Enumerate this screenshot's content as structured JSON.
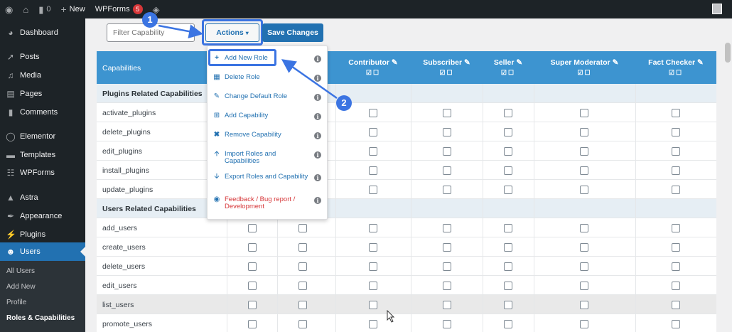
{
  "adminbar": {
    "comments_count": "0",
    "new_label": "New",
    "wpforms_label": "WPForms",
    "wpforms_badge": "5"
  },
  "sidebar": {
    "items": [
      {
        "label": "Dashboard",
        "icon": "dashboard-icon"
      },
      {
        "label": "Posts",
        "icon": "pin-icon"
      },
      {
        "label": "Media",
        "icon": "media-icon"
      },
      {
        "label": "Pages",
        "icon": "pages-icon"
      },
      {
        "label": "Comments",
        "icon": "comment-icon"
      },
      {
        "label": "Elementor",
        "icon": "elementor-icon"
      },
      {
        "label": "Templates",
        "icon": "folder-icon"
      },
      {
        "label": "WPForms",
        "icon": "form-icon"
      },
      {
        "label": "Astra",
        "icon": "astra-icon"
      },
      {
        "label": "Appearance",
        "icon": "brush-icon"
      },
      {
        "label": "Plugins",
        "icon": "plug-icon"
      },
      {
        "label": "Users",
        "icon": "user-icon"
      }
    ],
    "submenu": [
      "All Users",
      "Add New",
      "Profile",
      "Roles & Capabilities"
    ]
  },
  "toolbar": {
    "filter_placeholder": "Filter Capability",
    "actions_label": "Actions",
    "save_label": "Save Changes"
  },
  "table": {
    "first_header": "Capabilities",
    "role_headers": [
      "Contributor",
      "Subscriber",
      "Seller",
      "Super Moderator",
      "Fact Checker"
    ],
    "sections": [
      {
        "title": "Plugins Related Capabilities",
        "rows": [
          "activate_plugins",
          "delete_plugins",
          "edit_plugins",
          "install_plugins",
          "update_plugins"
        ]
      },
      {
        "title": "Users Related Capabilities",
        "rows": [
          "add_users",
          "create_users",
          "delete_users",
          "edit_users",
          "list_users",
          "promote_users"
        ]
      }
    ]
  },
  "dropdown": {
    "items": [
      {
        "label": "Add New Role",
        "icon": "plus-icon"
      },
      {
        "label": "Delete Role",
        "icon": "trash-icon"
      },
      {
        "label": "Change Default Role",
        "icon": "edit-icon"
      },
      {
        "label": "Add Capability",
        "icon": "plus-square-icon"
      },
      {
        "label": "Remove Capability",
        "icon": "x-icon"
      },
      {
        "label": "Import Roles and Capabilities",
        "icon": "arrow-up-icon"
      },
      {
        "label": "Export Roles and Capability",
        "icon": "arrow-down-icon"
      },
      {
        "label": "Feedback / Bug report / Development",
        "icon": "chat-icon"
      }
    ]
  },
  "callouts": [
    "1",
    "2"
  ],
  "colors": {
    "accent": "#2271b1",
    "header": "#3d94d0",
    "sidebar": "#1d2327",
    "callout": "#3b74e2"
  }
}
